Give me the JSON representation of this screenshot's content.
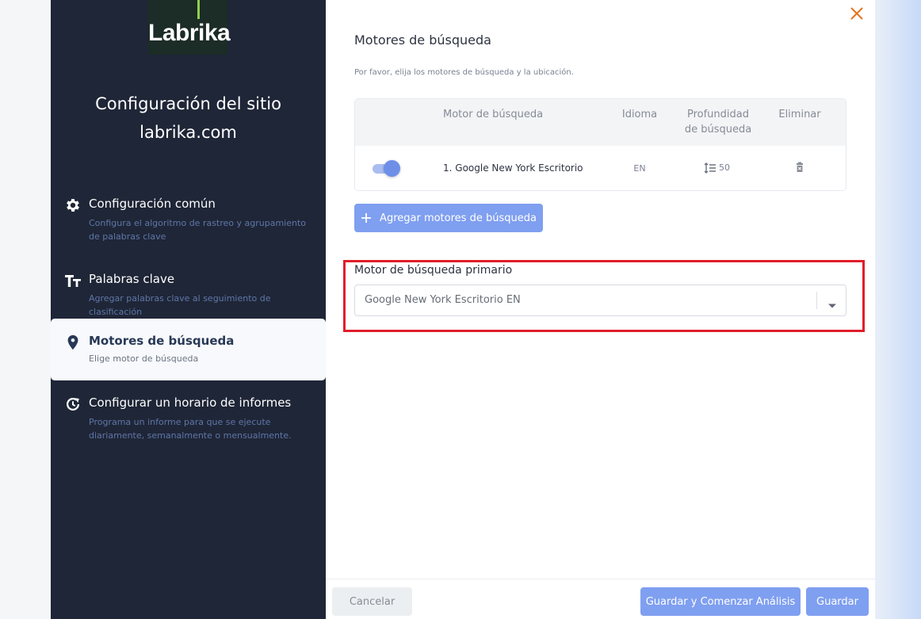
{
  "colors": {
    "sidebar_bg": "#1f2637",
    "accent_blue": "#7f9ff0",
    "close_orange": "#e5731e",
    "highlight_red": "#e01e2b",
    "logo_bar_green": "#8fd14f"
  },
  "logo": {
    "text": "Labrika"
  },
  "sidebar": {
    "title_line1": "Configuración del sitio",
    "title_line2": "labrika.com",
    "items": [
      {
        "icon": "gear-icon",
        "label": "Configuración común",
        "desc": "Configura el algoritmo de rastreo y agrupamiento de palabras clave",
        "active": false
      },
      {
        "icon": "text-size-icon",
        "label": "Palabras clave",
        "desc": "Agregar palabras clave al seguimiento de clasificación",
        "active": false
      },
      {
        "icon": "location-pin-icon",
        "label": "Motores de búsqueda",
        "desc": "Elige motor de búsqueda",
        "active": true
      },
      {
        "icon": "schedule-refresh-icon",
        "label": "Configurar un horario de informes",
        "desc": "Programa un informe para que se ejecute diariamente, semanalmente o mensualmente.",
        "active": false
      }
    ]
  },
  "main": {
    "title": "Motores de búsqueda",
    "subtitle": "Por favor, elija los motores de búsqueda y la ubicación.",
    "table": {
      "headers": {
        "engine": "Motor de búsqueda",
        "language": "Idioma",
        "depth_line1": "Profundidad",
        "depth_line2": "de búsqueda",
        "delete": "Eliminar"
      },
      "rows": [
        {
          "enabled": true,
          "engine": "1. Google New York Escritorio",
          "language": "EN",
          "depth": "50"
        }
      ]
    },
    "add_button": "Agregar motores de búsqueda",
    "primary_label": "Motor de búsqueda primario",
    "primary_value": "Google New York Escritorio EN"
  },
  "footer": {
    "cancel": "Cancelar",
    "save_and_start": "Guardar y Comenzar Análisis",
    "save": "Guardar"
  }
}
